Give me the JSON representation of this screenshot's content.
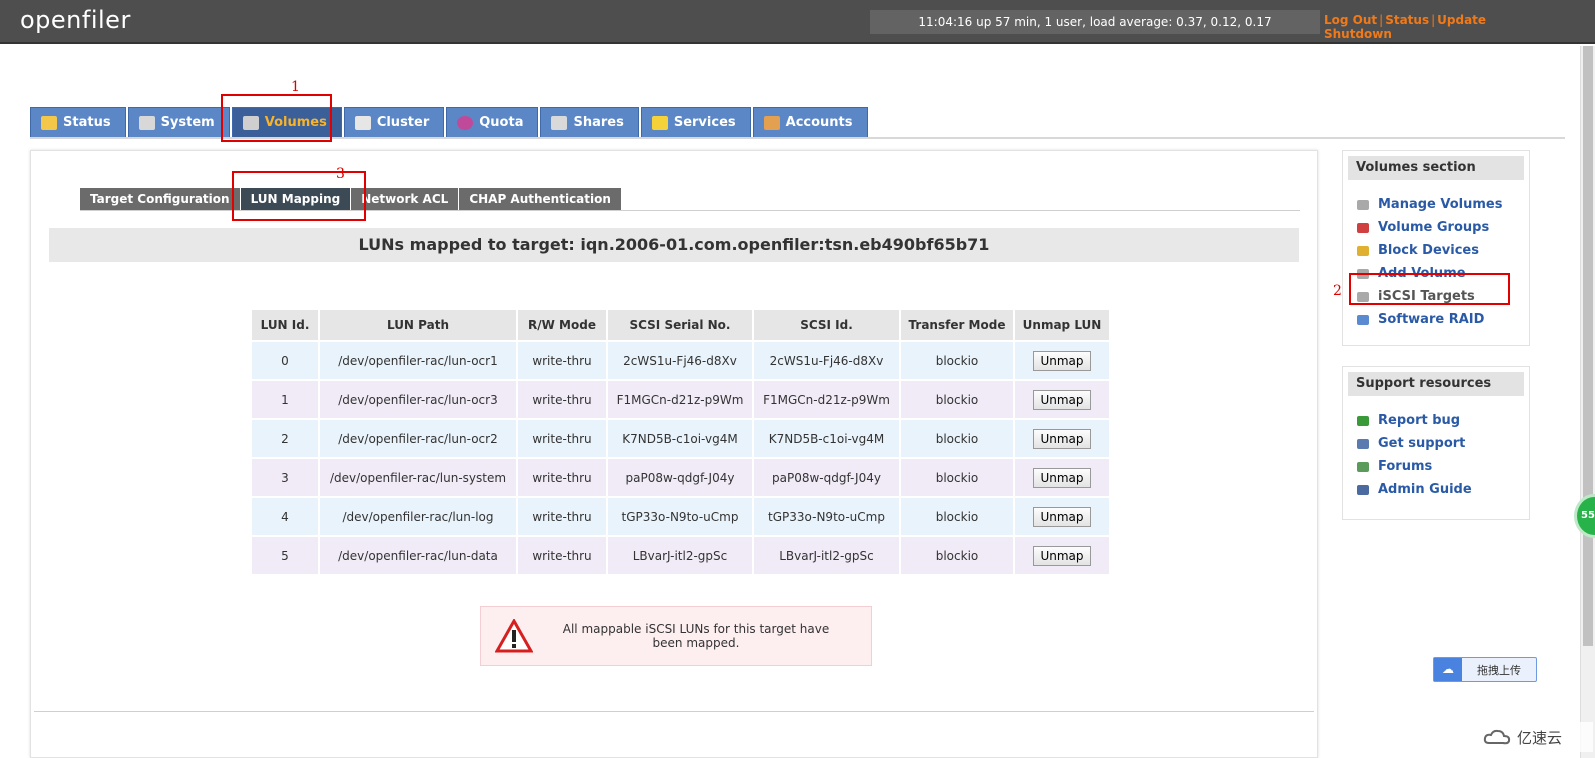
{
  "header": {
    "logo": "openfiler",
    "uptime": "11:04:16 up 57 min, 1 user, load average: 0.37, 0.12, 0.17",
    "links": {
      "logout": "Log Out",
      "status": "Status",
      "update": "Update",
      "shutdown": "Shutdown"
    }
  },
  "tabs": [
    {
      "label": "Status",
      "icon": "sun-icon"
    },
    {
      "label": "System",
      "icon": "monitor-icon"
    },
    {
      "label": "Volumes",
      "icon": "disk-icon",
      "active": true
    },
    {
      "label": "Cluster",
      "icon": "servers-icon"
    },
    {
      "label": "Quota",
      "icon": "pie-icon"
    },
    {
      "label": "Shares",
      "icon": "folder-icon"
    },
    {
      "label": "Services",
      "icon": "lightning-icon"
    },
    {
      "label": "Accounts",
      "icon": "users-icon"
    }
  ],
  "annotations": [
    "1",
    "2",
    "3"
  ],
  "subtabs": [
    {
      "label": "Target Configuration"
    },
    {
      "label": "LUN Mapping",
      "active": true
    },
    {
      "label": "Network ACL"
    },
    {
      "label": "CHAP Authentication"
    }
  ],
  "lun_section": {
    "title": "LUNs mapped to target: iqn.2006-01.com.openfiler:tsn.eb490bf65b71",
    "columns": [
      "LUN Id.",
      "LUN Path",
      "R/W Mode",
      "SCSI Serial No.",
      "SCSI Id.",
      "Transfer Mode",
      "Unmap LUN"
    ],
    "rows": [
      {
        "id": "0",
        "path": "/dev/openfiler-rac/lun-ocr1",
        "mode": "write-thru",
        "serial": "2cWS1u-Fj46-d8Xv",
        "scsi_id": "2cWS1u-Fj46-d8Xv",
        "transfer": "blockio",
        "action": "Unmap"
      },
      {
        "id": "1",
        "path": "/dev/openfiler-rac/lun-ocr3",
        "mode": "write-thru",
        "serial": "F1MGCn-d21z-p9Wm",
        "scsi_id": "F1MGCn-d21z-p9Wm",
        "transfer": "blockio",
        "action": "Unmap"
      },
      {
        "id": "2",
        "path": "/dev/openfiler-rac/lun-ocr2",
        "mode": "write-thru",
        "serial": "K7ND5B-c1oi-vg4M",
        "scsi_id": "K7ND5B-c1oi-vg4M",
        "transfer": "blockio",
        "action": "Unmap"
      },
      {
        "id": "3",
        "path": "/dev/openfiler-rac/lun-system",
        "mode": "write-thru",
        "serial": "paP08w-qdgf-J04y",
        "scsi_id": "paP08w-qdgf-J04y",
        "transfer": "blockio",
        "action": "Unmap"
      },
      {
        "id": "4",
        "path": "/dev/openfiler-rac/lun-log",
        "mode": "write-thru",
        "serial": "tGP33o-N9to-uCmp",
        "scsi_id": "tGP33o-N9to-uCmp",
        "transfer": "blockio",
        "action": "Unmap"
      },
      {
        "id": "5",
        "path": "/dev/openfiler-rac/lun-data",
        "mode": "write-thru",
        "serial": "LBvarJ-itl2-gpSc",
        "scsi_id": "LBvarJ-itl2-gpSc",
        "transfer": "blockio",
        "action": "Unmap"
      }
    ],
    "notice": "All mappable iSCSI LUNs for this target have been mapped."
  },
  "volumes_section": {
    "title": "Volumes section",
    "items": [
      {
        "label": "Manage Volumes",
        "icon": "disk-icon",
        "color": "#a9a9a9"
      },
      {
        "label": "Volume Groups",
        "icon": "cubes-icon",
        "color": "#d04040"
      },
      {
        "label": "Block Devices",
        "icon": "drive-icon",
        "color": "#e0b030"
      },
      {
        "label": "Add Volume",
        "icon": "disk-add-icon",
        "color": "#a9a9a9"
      },
      {
        "label": "iSCSI Targets",
        "icon": "target-icon",
        "color": "#a9a9a9",
        "active": true
      },
      {
        "label": "Software RAID",
        "icon": "raid-icon",
        "color": "#5a8ad0"
      }
    ]
  },
  "support_section": {
    "title": "Support resources",
    "items": [
      {
        "label": "Report bug",
        "icon": "bug-icon",
        "color": "#3a9a3a"
      },
      {
        "label": "Get support",
        "icon": "support-icon",
        "color": "#5a7ab0"
      },
      {
        "label": "Forums",
        "icon": "forum-icon",
        "color": "#5a9a5a"
      },
      {
        "label": "Admin Guide",
        "icon": "book-icon",
        "color": "#4a6aa0"
      }
    ]
  },
  "widgets": {
    "upload_label": "拖拽上传",
    "badge_text": "55",
    "watermark": "亿速云"
  },
  "colors": {
    "topbar": "#4e4e4e",
    "tab": "#5b87c6",
    "tab_active": "#3a5f99",
    "accent_orange": "#f07a1a",
    "link_blue": "#2a5aa6",
    "annotation_red": "#e00000"
  }
}
